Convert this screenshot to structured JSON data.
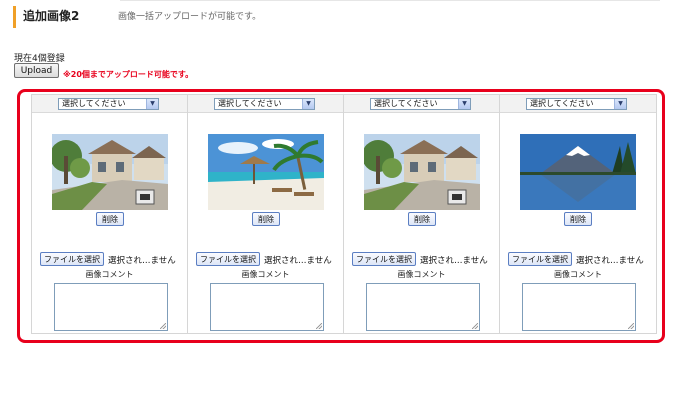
{
  "header": {
    "title": "追加画像2",
    "description": "画像一括アップロードが可能です。"
  },
  "upload": {
    "count_text": "現在4個登録",
    "button_label": "Upload",
    "limit_note": "※20個までアップロード可能です。"
  },
  "slots": [
    {
      "select_value": "選択してください",
      "image": "house-street-photo",
      "delete_label": "削除",
      "file_button_label": "ファイルを選択",
      "file_status": "選択され…ません",
      "comment_label": "画像コメント",
      "comment_value": ""
    },
    {
      "select_value": "選択してください",
      "image": "beach-umbrella-photo",
      "delete_label": "削除",
      "file_button_label": "ファイルを選択",
      "file_status": "選択され…ません",
      "comment_label": "画像コメント",
      "comment_value": ""
    },
    {
      "select_value": "選択してください",
      "image": "house-street-photo",
      "delete_label": "削除",
      "file_button_label": "ファイルを選択",
      "file_status": "選択され…ません",
      "comment_label": "画像コメント",
      "comment_value": ""
    },
    {
      "select_value": "選択してください",
      "image": "mount-fuji-lake-photo",
      "delete_label": "削除",
      "file_button_label": "ファイルを選択",
      "file_status": "選択され…ません",
      "comment_label": "画像コメント",
      "comment_value": ""
    }
  ],
  "colors": {
    "accent_bar": "#f0a028",
    "highlight_frame": "#e8001c",
    "note_text": "#e8001c"
  }
}
